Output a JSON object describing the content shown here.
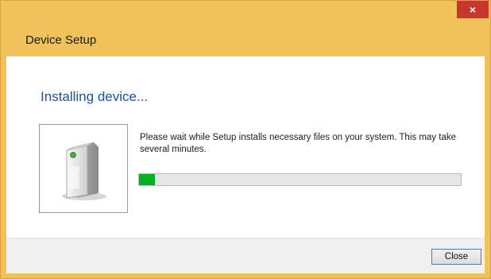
{
  "window": {
    "title": "Device Setup",
    "close_glyph": "×"
  },
  "main": {
    "heading": "Installing device...",
    "message": "Please wait while Setup installs necessary files on your system. This may take several minutes.",
    "device_icon": "device-server-icon",
    "progress_fraction": 0.05
  },
  "footer": {
    "close_label": "Close"
  },
  "colors": {
    "title_bar": "#f0c25a",
    "heading_text": "#1d50a2",
    "progress_fill": "#06b025",
    "close_x_bg": "#c7372f"
  }
}
